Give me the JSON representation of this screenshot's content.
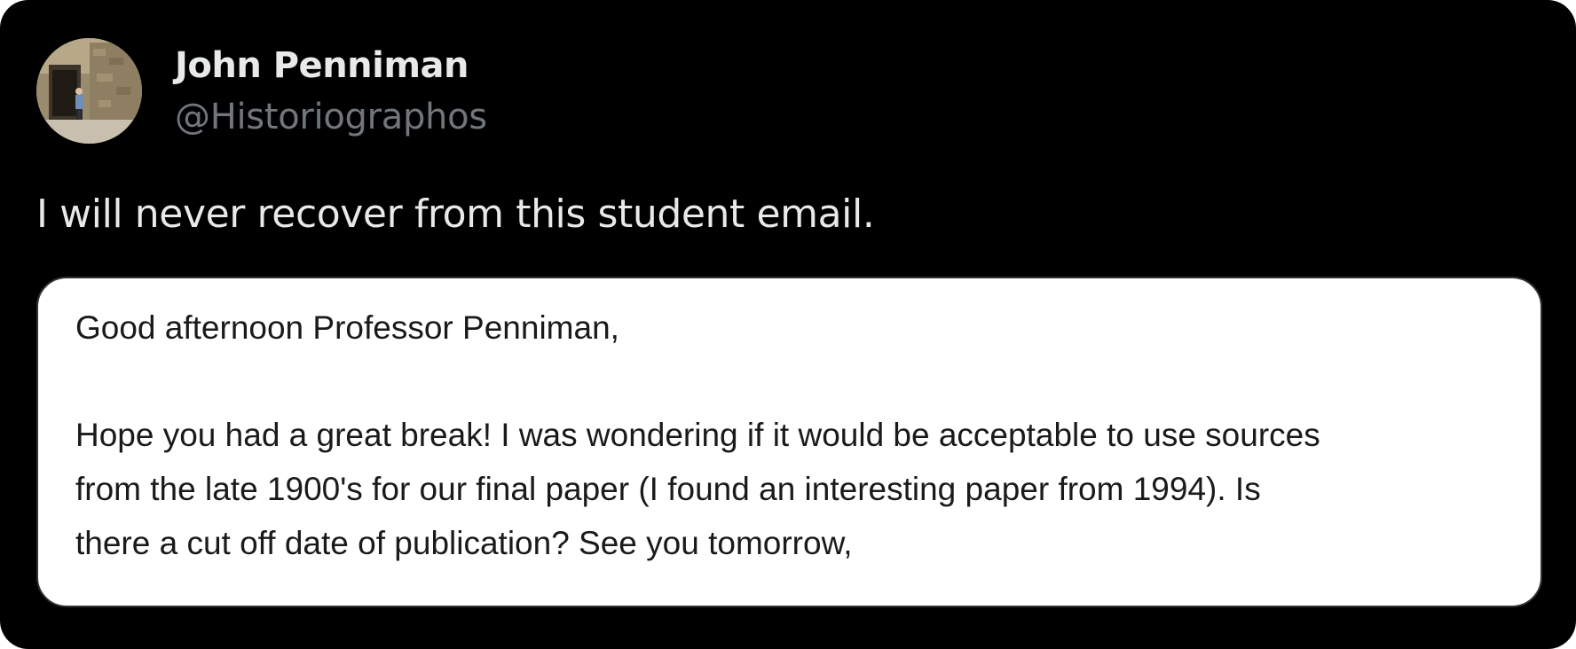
{
  "tweet": {
    "author": {
      "display_name": "John Penniman",
      "handle": "@Historiographos",
      "avatar_icon": "profile-photo-avatar"
    },
    "text": "I will never recover from this student email.",
    "colors": {
      "background": "#000000",
      "primary_text": "#e7e9ea",
      "secondary_text": "#71767b",
      "card_border": "#2f3336"
    }
  },
  "email_image": {
    "greeting": "Good afternoon Professor Penniman,",
    "body_lines": [
      "Hope you had a great break! I was wondering if it would be acceptable to use sources",
      "from the late 1900's for our final paper (I found an interesting paper from 1994). Is",
      "there a cut off date of publication? See you tomorrow,"
    ]
  }
}
